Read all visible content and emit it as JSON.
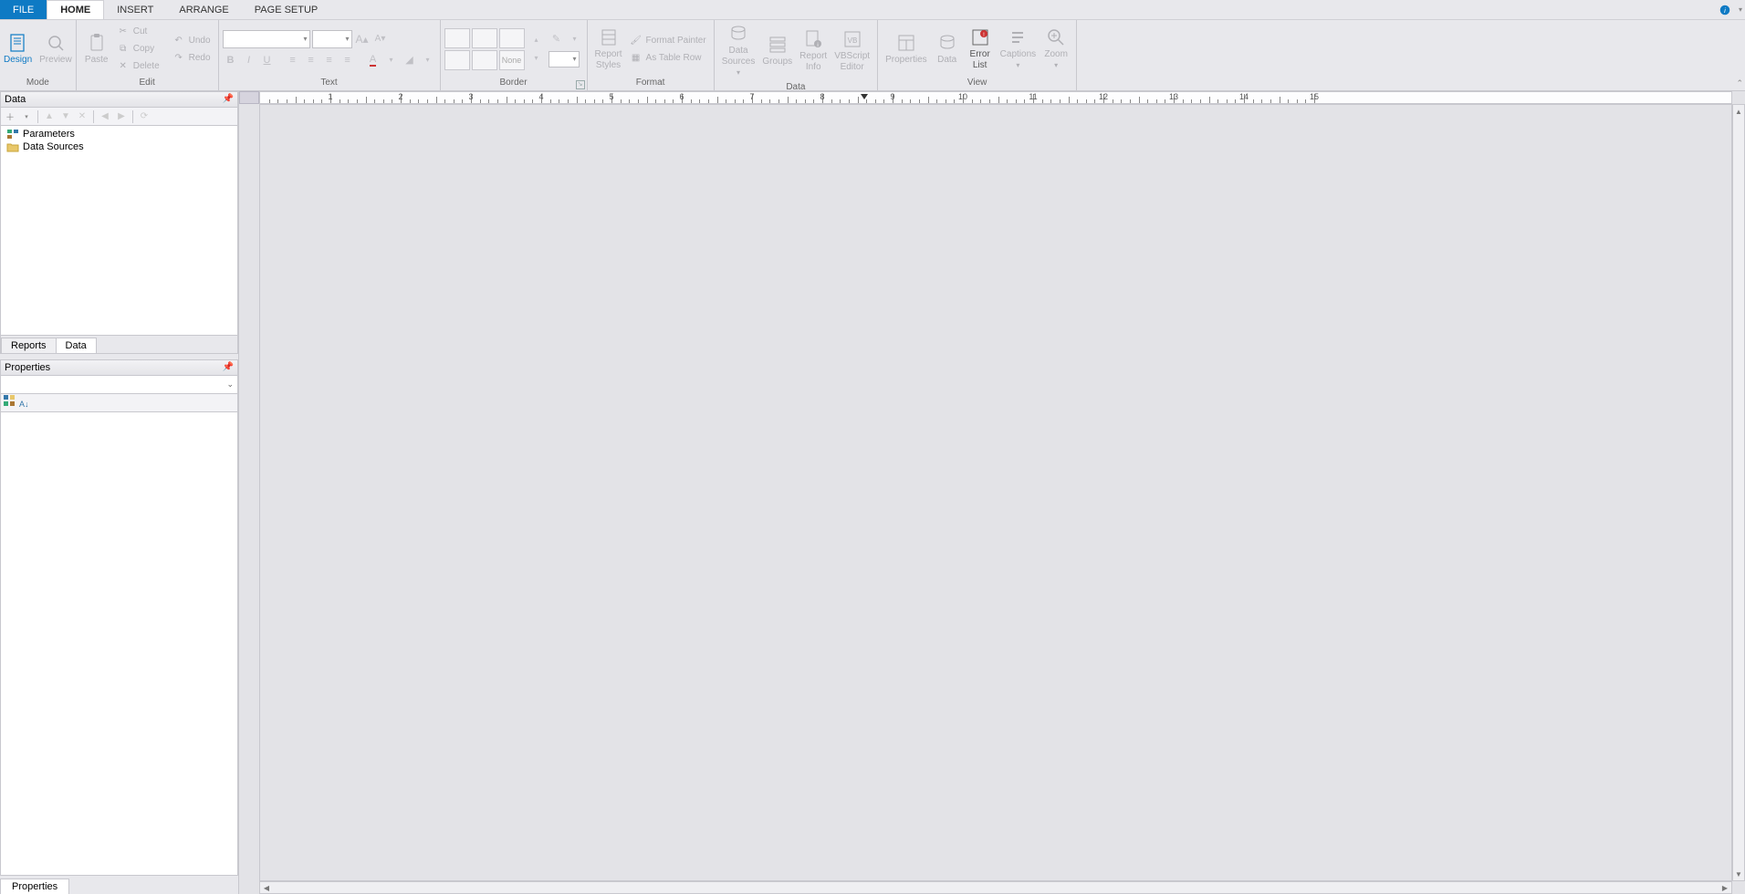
{
  "tabs": {
    "file": "FILE",
    "home": "HOME",
    "insert": "INSERT",
    "arrange": "ARRANGE",
    "page_setup": "PAGE SETUP",
    "active": "HOME"
  },
  "ribbon": {
    "groups": {
      "mode": {
        "label": "Mode",
        "design": "Design",
        "preview": "Preview"
      },
      "edit": {
        "label": "Edit",
        "paste": "Paste",
        "cut": "Cut",
        "copy": "Copy",
        "delete": "Delete",
        "undo": "Undo",
        "redo": "Redo"
      },
      "text": {
        "label": "Text",
        "font": "",
        "size": ""
      },
      "border": {
        "label": "Border",
        "none": "None"
      },
      "format": {
        "label": "Format",
        "report_styles": "Report\nStyles",
        "format_painter": "Format Painter",
        "as_table_row": "As Table Row"
      },
      "data": {
        "label": "Data",
        "data_sources": "Data\nSources",
        "groups": "Groups",
        "report_info": "Report\nInfo",
        "vbscript": "VBScript\nEditor"
      },
      "view": {
        "label": "View",
        "properties": "Properties",
        "data": "Data",
        "error_list": "Error\nList",
        "captions": "Captions",
        "zoom": "Zoom"
      }
    }
  },
  "left": {
    "data_panel": {
      "title": "Data",
      "tree": {
        "parameters": "Parameters",
        "data_sources": "Data Sources"
      },
      "tabs": {
        "reports": "Reports",
        "data": "Data",
        "active": "Data"
      }
    },
    "properties_panel": {
      "title": "Properties",
      "bottom_tab": "Properties"
    }
  },
  "ruler": {
    "ticks": [
      "1",
      "2",
      "3",
      "4",
      "5",
      "6",
      "7",
      "8",
      "9",
      "10",
      "11",
      "12",
      "13",
      "14",
      "15"
    ],
    "marker_at": 8.6
  }
}
